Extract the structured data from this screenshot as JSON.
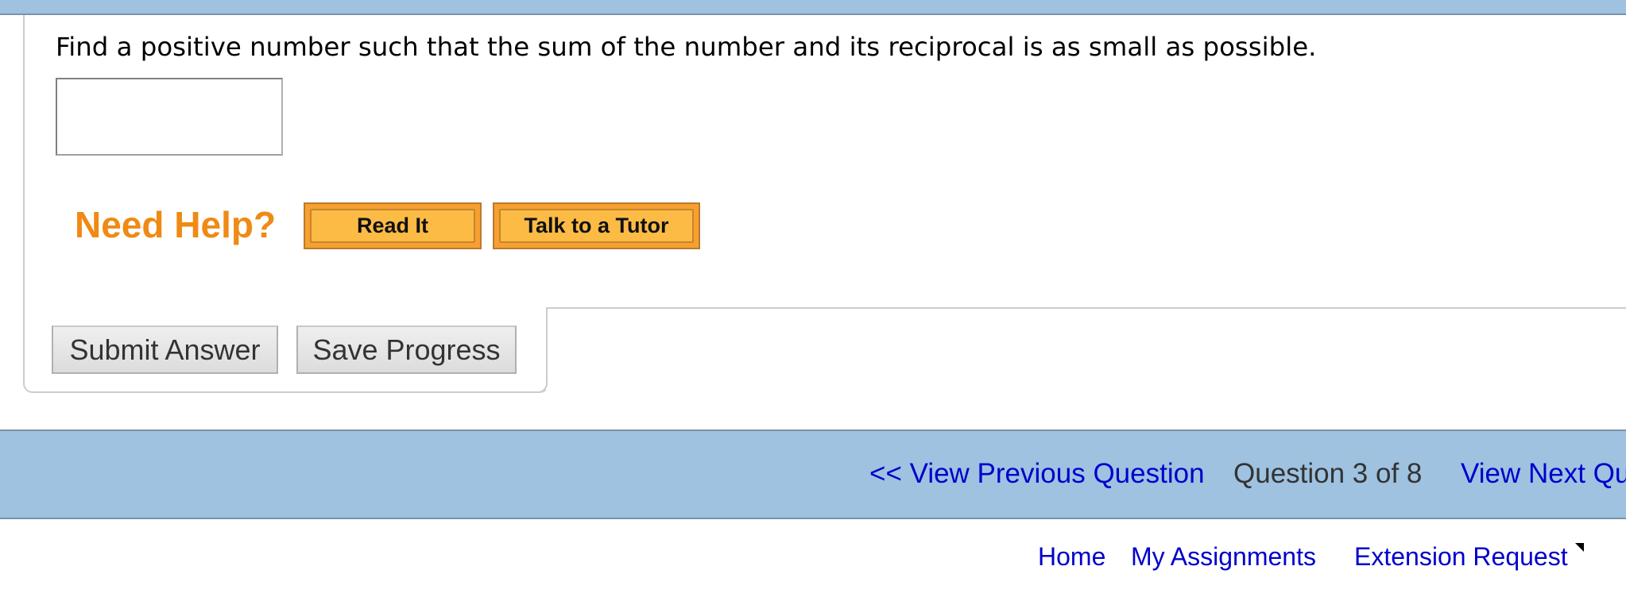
{
  "question": {
    "text": "Find a positive number such that the sum of the number and its reciprocal is as small as possible.",
    "answer_value": "",
    "answer_placeholder": ""
  },
  "help": {
    "label": "Need Help?",
    "buttons": [
      {
        "label": "Read It"
      },
      {
        "label": "Talk to a Tutor"
      }
    ]
  },
  "actions": {
    "submit_label": "Submit Answer",
    "save_label": "Save Progress"
  },
  "navigation": {
    "previous_label": "<< View Previous Question",
    "counter": "Question 3 of 8",
    "next_label": "View Next Question"
  },
  "footer": {
    "links": [
      {
        "label": "Home"
      },
      {
        "label": "My Assignments"
      },
      {
        "label": "Extension Request",
        "icon": "external-link-icon"
      }
    ]
  },
  "colors": {
    "bar_blue": "#9ec2e0",
    "link_blue": "#0000cc",
    "help_orange": "#ef8a14",
    "button_orange": "#f7a030"
  }
}
